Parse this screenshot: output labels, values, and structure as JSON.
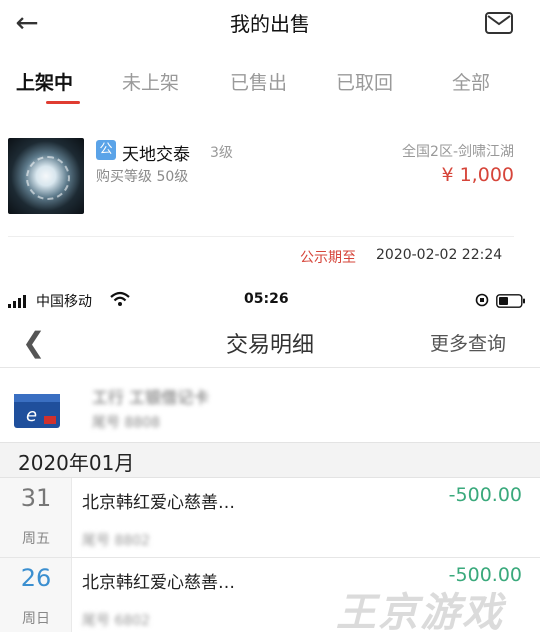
{
  "my_sales": {
    "title": "我的出售",
    "tabs": [
      {
        "label": "上架中",
        "active": true
      },
      {
        "label": "未上架"
      },
      {
        "label": "已售出"
      },
      {
        "label": "已取回"
      },
      {
        "label": "全部"
      }
    ],
    "item": {
      "badge": "公",
      "name": "天地交泰",
      "level": "3级",
      "buy_level": "购买等级 50级",
      "server": "全国2区-剑啸江湖",
      "price": "¥ 1,000",
      "publicity_label": "公示期至",
      "publicity_time": "2020-02-02 22:24"
    },
    "accent_color": "#e03c31"
  },
  "phone_status": {
    "carrier": "中国移动",
    "time": "05:26"
  },
  "transaction_detail": {
    "title": "交易明细",
    "more": "更多查询",
    "card": {
      "bank_name": "工行 工银借记卡",
      "tail": "尾号 8808"
    },
    "month": "2020年01月",
    "rows": [
      {
        "day": "31",
        "weekday": "周五",
        "merchant": "北京韩红爱心慈善…",
        "amount": "-500.00",
        "tail": "尾号 8802"
      },
      {
        "day": "26",
        "weekday": "周日",
        "merchant": "北京韩红爱心慈善…",
        "amount": "-500.00",
        "tail": "尾号 6802"
      }
    ],
    "amount_color": "#3aa97c"
  },
  "watermark": "王京游戏"
}
